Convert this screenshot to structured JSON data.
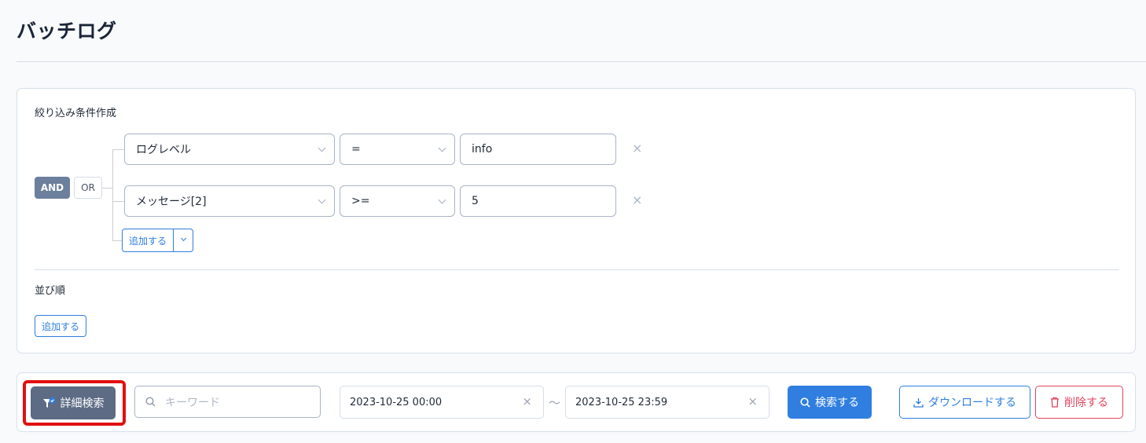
{
  "page": {
    "title": "バッチログ"
  },
  "filter": {
    "section_label": "絞り込み条件作成",
    "logic": {
      "and_label": "AND",
      "or_label": "OR",
      "selected": "AND"
    },
    "conditions": [
      {
        "field": "ログレベル",
        "operator": "=",
        "value": "info",
        "remove": "×"
      },
      {
        "field": "メッセージ[2]",
        "operator": ">=",
        "value": "5",
        "remove": "×"
      }
    ],
    "add_label": "追加する"
  },
  "sort": {
    "section_label": "並び順",
    "add_label": "追加する"
  },
  "search_bar": {
    "advanced_label": "詳細検索",
    "keyword_placeholder": "キーワード",
    "date_from": "2023-10-25 00:00",
    "date_to": "2023-10-25 23:59",
    "range_separator": "〜",
    "clear_symbol": "×",
    "search_label": "検索する",
    "download_label": "ダウンロードする",
    "delete_label": "削除する"
  },
  "colors": {
    "primary": "#2f7ee0",
    "danger": "#e0435c",
    "highlight": "#e11010",
    "and_active": "#6c7f9d"
  }
}
